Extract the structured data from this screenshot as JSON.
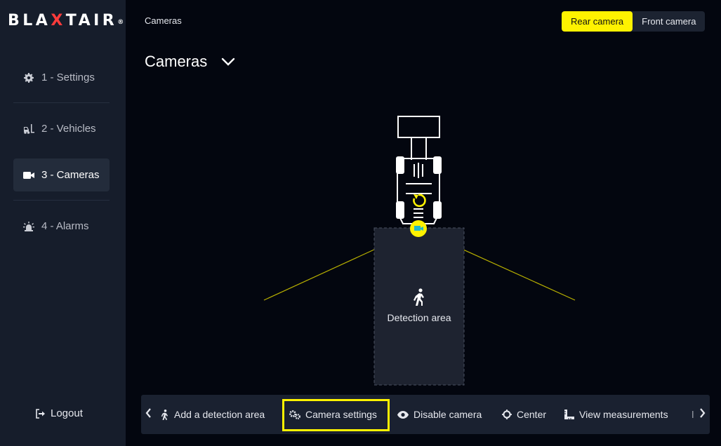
{
  "brand": {
    "logo_pre": "BLA",
    "logo_x": "X",
    "logo_post": "TAIR",
    "logo_mark": "®",
    "accent": "#fff200"
  },
  "sidebar": {
    "items": [
      {
        "label": "1 - Settings",
        "icon": "gear-icon"
      },
      {
        "label": "2 - Vehicles",
        "icon": "forklift-icon"
      },
      {
        "label": "3 - Cameras",
        "icon": "video-camera-icon",
        "active": true
      },
      {
        "label": "4 - Alarms",
        "icon": "alarm-siren-icon"
      }
    ],
    "logout_label": "Logout"
  },
  "header": {
    "breadcrumb": "Cameras",
    "title": "Cameras",
    "camera_toggle": {
      "options": [
        "Rear camera",
        "Front camera"
      ],
      "selected": "Rear camera"
    }
  },
  "scene": {
    "detection_area_label": "Detection area"
  },
  "toolbar": {
    "items": [
      {
        "label": "Add a detection area",
        "icon": "walking-person-icon"
      },
      {
        "label": "Camera settings",
        "icon": "gears-icon",
        "highlighted": true
      },
      {
        "label": "Disable camera",
        "icon": "eye-icon"
      },
      {
        "label": "Center",
        "icon": "crosshair-icon"
      },
      {
        "label": "View measurements",
        "icon": "ruler-icon"
      }
    ]
  }
}
